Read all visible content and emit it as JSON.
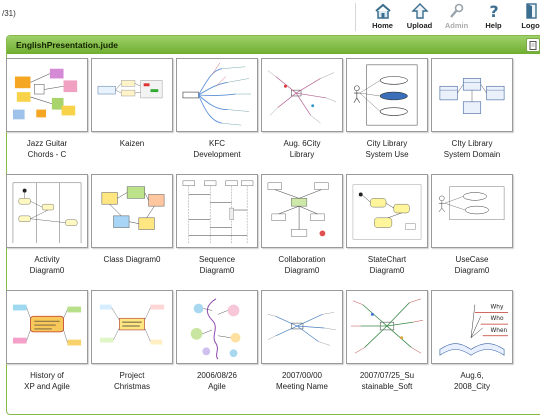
{
  "top": {
    "left_text": "/31)"
  },
  "nav": [
    {
      "label": "Home",
      "icon": "home-icon",
      "disabled": false
    },
    {
      "label": "Upload",
      "icon": "upload-icon",
      "disabled": false
    },
    {
      "label": "Admin",
      "icon": "admin-icon",
      "disabled": true
    },
    {
      "label": "Help",
      "icon": "help-icon",
      "disabled": false
    },
    {
      "label": "Logo",
      "icon": "logout-icon",
      "disabled": false
    }
  ],
  "panel": {
    "title": "EnglishPresentation.jude"
  },
  "colors": {
    "panel_header_top": "#9fd16a",
    "panel_header_bottom": "#6fae2f",
    "panel_border": "#86b84a",
    "nav_icon": "#3b6e8f"
  },
  "diagrams": [
    {
      "line1": "Jazz Guitar",
      "line2": "Chords  - C",
      "kind": "mindmap-color"
    },
    {
      "line1": "Kaizen",
      "line2": "",
      "kind": "simple"
    },
    {
      "line1": "KFC",
      "line2": "Development",
      "kind": "mindmap"
    },
    {
      "line1": "Aug. 6City",
      "line2": "Library",
      "kind": "mindmap-small"
    },
    {
      "line1": "City Library",
      "line2": "System Use",
      "kind": "usecase"
    },
    {
      "line1": "CIty Library",
      "line2": "System Domain",
      "kind": "class"
    },
    {
      "line1": "Activity",
      "line2": "Diagram0",
      "kind": "activity"
    },
    {
      "line1": "Class Diagram0",
      "line2": "",
      "kind": "class-color"
    },
    {
      "line1": "Sequence",
      "line2": "Diagram0",
      "kind": "sequence"
    },
    {
      "line1": "Collaboration",
      "line2": "Diagram0",
      "kind": "collab"
    },
    {
      "line1": "StateChart",
      "line2": "Diagram0",
      "kind": "state"
    },
    {
      "line1": "UseCase",
      "line2": "Diagram0",
      "kind": "usecase-small"
    },
    {
      "line1": "History of",
      "line2": "XP and Agile",
      "kind": "history"
    },
    {
      "line1": "Project",
      "line2": "Christmas",
      "kind": "christmas"
    },
    {
      "line1": "2006/08/26",
      "line2": "Agile",
      "kind": "agile"
    },
    {
      "line1": "2007/00/00",
      "line2": "Meeting Name",
      "kind": "meeting"
    },
    {
      "line1": "2007/07/25_Su",
      "line2": "stainable_Soft",
      "kind": "sustain"
    },
    {
      "line1": "Aug.6,",
      "line2": "2008_City",
      "kind": "whowho"
    }
  ]
}
